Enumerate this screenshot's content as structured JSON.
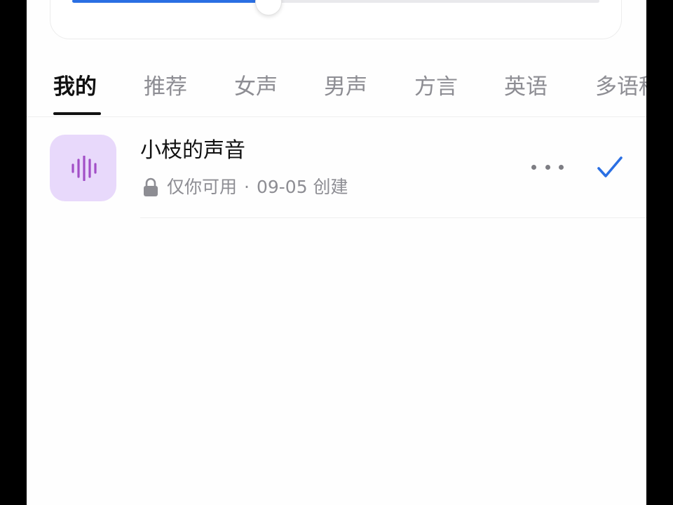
{
  "slider": {
    "fraction": 0.372,
    "fill_color": "#2a6fe3"
  },
  "tabs": [
    {
      "label": "我的",
      "active": true
    },
    {
      "label": "推荐",
      "active": false
    },
    {
      "label": "女声",
      "active": false
    },
    {
      "label": "男声",
      "active": false
    },
    {
      "label": "方言",
      "active": false
    },
    {
      "label": "英语",
      "active": false
    },
    {
      "label": "多语种",
      "active": false
    }
  ],
  "voice_item": {
    "title": "小枝的声音",
    "visibility": "仅你可用",
    "separator": "·",
    "created": "09-05 创建",
    "selected": true,
    "thumb_icon": "sound-wave-icon",
    "thumb_color": "#e8d9fb",
    "wave_color": "#a24fc7",
    "check_color": "#2a6fe3"
  }
}
